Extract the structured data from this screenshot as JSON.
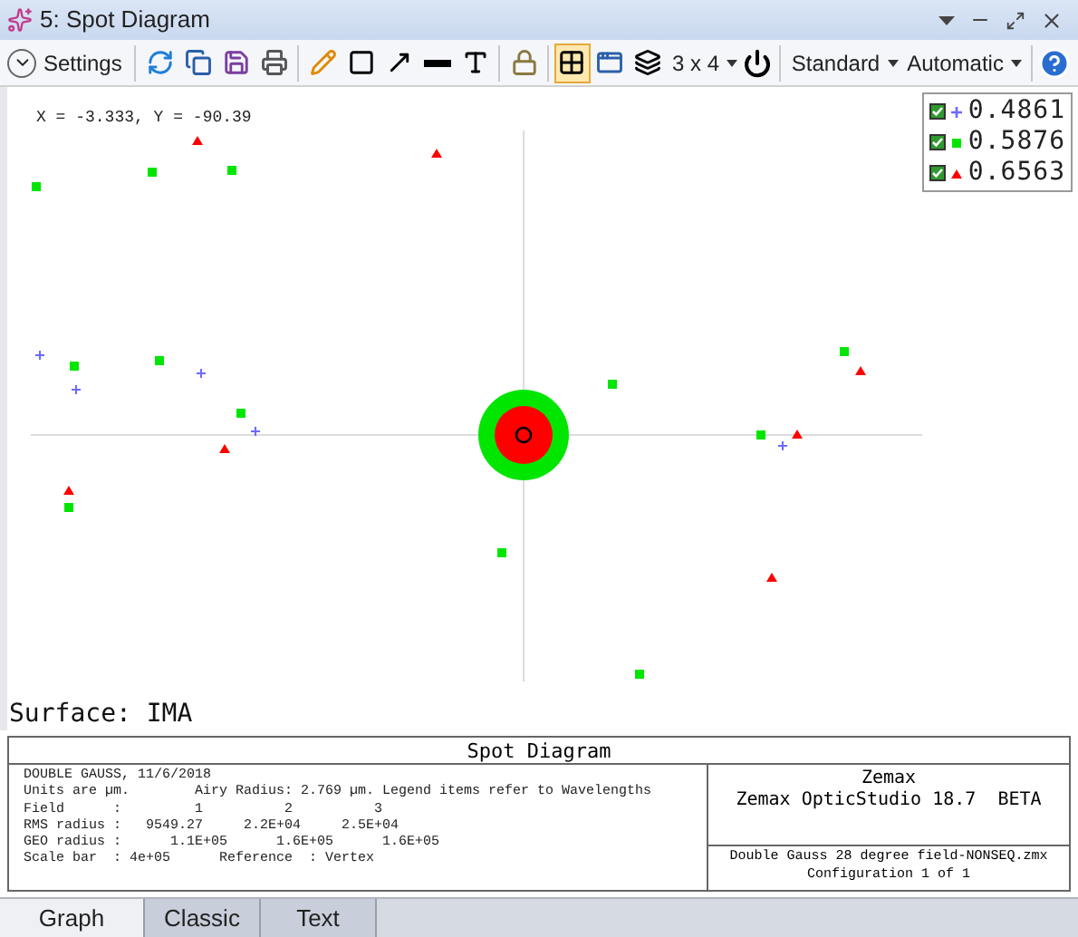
{
  "window": {
    "title": "5: Spot Diagram"
  },
  "toolbar": {
    "settings_label": "Settings",
    "tools": [
      {
        "kind": "refresh",
        "selected": false
      },
      {
        "kind": "copy",
        "selected": false
      },
      {
        "kind": "save",
        "selected": false
      },
      {
        "kind": "print",
        "selected": false
      },
      {
        "kind": "pencil",
        "selected": false
      },
      {
        "kind": "rectangle",
        "selected": false
      },
      {
        "kind": "arrow",
        "selected": false
      },
      {
        "kind": "line",
        "selected": false
      },
      {
        "kind": "text",
        "selected": false
      },
      {
        "kind": "lock",
        "selected": false
      },
      {
        "kind": "grid",
        "selected": true
      },
      {
        "kind": "windows",
        "selected": false
      },
      {
        "kind": "layers",
        "selected": false
      }
    ],
    "layout_menu": "3 x 4",
    "standard_menu": "Standard",
    "automatic_menu": "Automatic"
  },
  "plot": {
    "cursor_readout": "X = -3.333, Y = -90.39",
    "surface_label": "Surface: IMA",
    "legend": [
      {
        "kind": "plus",
        "checked": true,
        "color": "#6a6aff",
        "label": "0.4861"
      },
      {
        "kind": "square",
        "checked": true,
        "color": "#00e600",
        "label": "0.5876"
      },
      {
        "kind": "triangle",
        "checked": true,
        "color": "#ff0000",
        "label": "0.6563"
      }
    ]
  },
  "info": {
    "title": "Spot Diagram",
    "left_lines": [
      "DOUBLE GAUSS, 11/6/2018",
      "Units are µm.        Airy Radius: 2.769 µm. Legend items refer to Wavelengths",
      "Field      :         1          2          3",
      "RMS radius :   9549.27     2.2E+04     2.5E+04",
      "GEO radius :      1.1E+05      1.6E+05      1.6E+05",
      "Scale bar  : 4e+05      Reference  : Vertex"
    ],
    "right_top_lines": [
      "Zemax",
      "Zemax OpticStudio 18.7  BETA"
    ],
    "right_bottom_lines": [
      "Double Gauss 28 degree field-NONSEQ.zmx",
      "Configuration 1 of 1"
    ]
  },
  "tabs": [
    {
      "label": "Graph",
      "selected": true
    },
    {
      "label": "Classic",
      "selected": false
    },
    {
      "label": "Text",
      "selected": false
    }
  ]
}
